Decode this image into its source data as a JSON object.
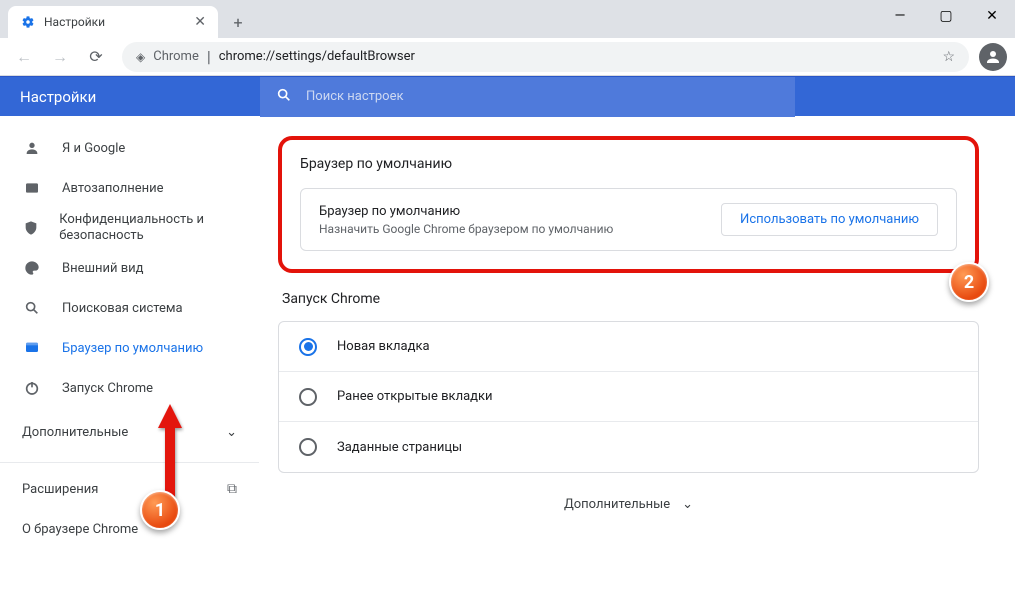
{
  "tab": {
    "title": "Настройки"
  },
  "omnibox": {
    "prefix": "Chrome",
    "path": "chrome://settings/defaultBrowser"
  },
  "header": {
    "title": "Настройки",
    "search_placeholder": "Поиск настроек"
  },
  "sidebar": {
    "items": [
      {
        "label": "Я и Google"
      },
      {
        "label": "Автозаполнение"
      },
      {
        "label": "Конфиденциальность и безопасность"
      },
      {
        "label": "Внешний вид"
      },
      {
        "label": "Поисковая система"
      },
      {
        "label": "Браузер по умолчанию"
      },
      {
        "label": "Запуск Chrome"
      }
    ],
    "advanced": "Дополнительные",
    "extensions": "Расширения",
    "about": "О браузере Chrome"
  },
  "main": {
    "default_section_title": "Браузер по умолчанию",
    "card_title": "Браузер по умолчанию",
    "card_subtitle": "Назначить Google Chrome браузером по умолчанию",
    "default_button": "Использовать по умолчанию",
    "startup_section_title": "Запуск Chrome",
    "radio": [
      "Новая вкладка",
      "Ранее открытые вкладки",
      "Заданные страницы"
    ],
    "footer_advanced": "Дополнительные"
  },
  "annotations": {
    "badge1": "1",
    "badge2": "2"
  }
}
